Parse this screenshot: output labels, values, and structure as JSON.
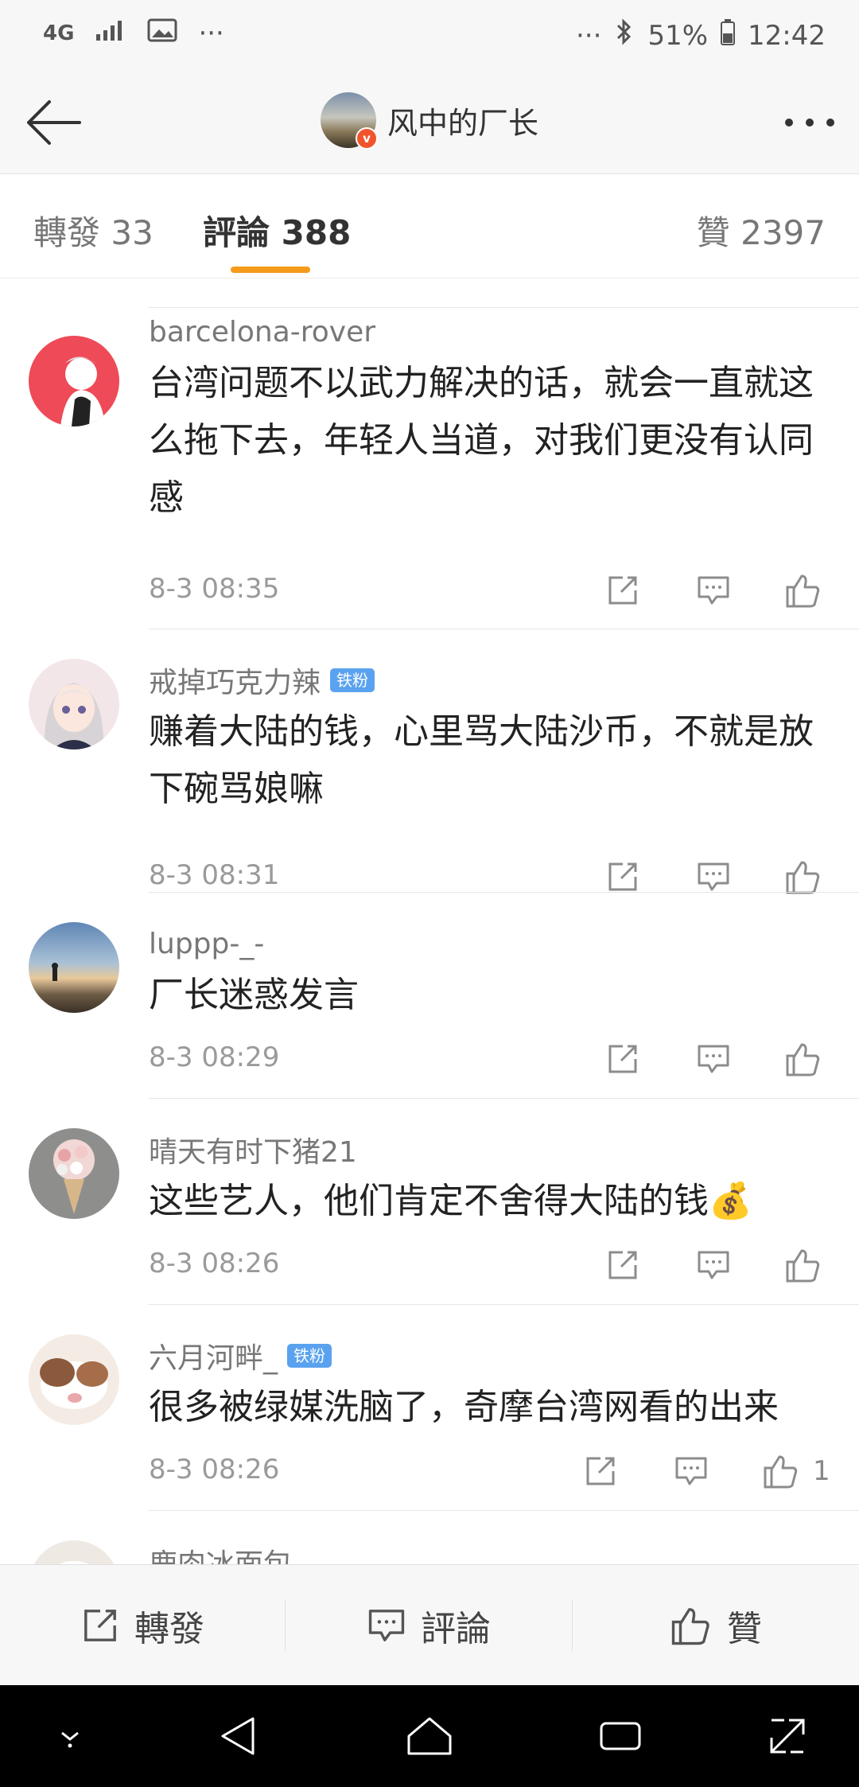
{
  "status_bar": {
    "network": "4G",
    "battery": "51%",
    "time": "12:42",
    "dots_left": "···",
    "dots_right": "···"
  },
  "header": {
    "title": "风中的厂长"
  },
  "tabs": [
    {
      "label": "轉發 33"
    },
    {
      "label": "評論 388"
    },
    {
      "label": "贊 2397"
    }
  ],
  "comments": [
    {
      "user": "barcelona-rover",
      "badge": "",
      "text": "台湾问题不以武力解决的话，就会一直就这么拖下去，年轻人当道，对我们更没有认同感",
      "time": "8-3 08:35",
      "likes": ""
    },
    {
      "user": "戒掉巧克力辣",
      "badge": "铁粉",
      "text": "赚着大陆的钱，心里骂大陆沙币，不就是放下碗骂娘嘛",
      "time": "8-3 08:31",
      "likes": ""
    },
    {
      "user": "luppp-_-",
      "badge": "",
      "text": "厂长迷惑发言",
      "time": "8-3 08:29",
      "likes": ""
    },
    {
      "user": "晴天有时下猪21",
      "badge": "",
      "text": "这些艺人，他们肯定不舍得大陆的钱💰",
      "time": "8-3 08:26",
      "likes": ""
    },
    {
      "user": "六月河畔_",
      "badge": "铁粉",
      "text": "很多被绿媒洗脑了，奇摩台湾网看的出来",
      "time": "8-3 08:26",
      "likes": "1"
    },
    {
      "user": "鹿肉冰面包",
      "badge": "",
      "text": "",
      "time": "",
      "likes": ""
    }
  ],
  "bottom_bar": {
    "repost": "轉發",
    "comment": "評論",
    "like": "贊"
  },
  "icons": {
    "back": "arrow-left-icon",
    "more": "more-dots-icon",
    "repost": "share-out-icon",
    "comment": "comment-bubble-icon",
    "like": "thumbs-up-icon",
    "nav_down": "chevron-down-icon",
    "nav_back": "triangle-back-icon",
    "nav_home": "home-icon",
    "nav_recent": "recent-apps-icon",
    "nav_expand": "expand-icon"
  },
  "colors": {
    "accent": "#f59b1b",
    "badge": "#5aa2ef",
    "verified": "#f1542c"
  }
}
